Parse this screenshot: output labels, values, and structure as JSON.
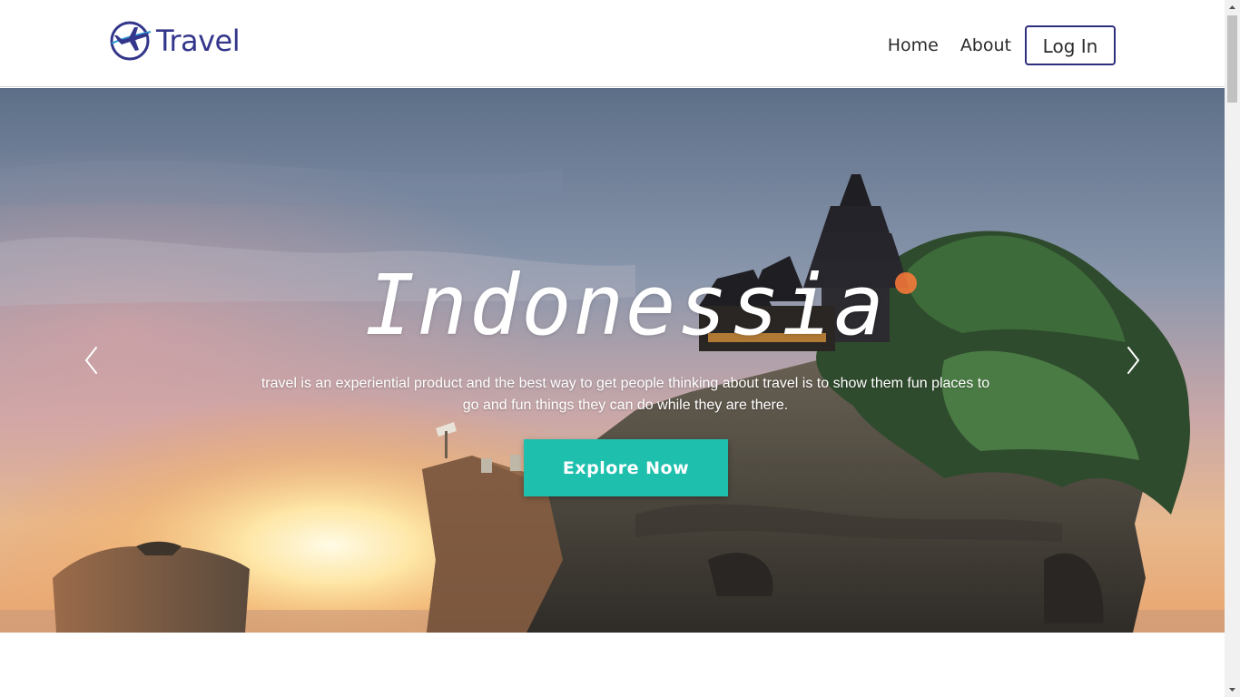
{
  "header": {
    "logo_text": "Travel",
    "nav": {
      "home": "Home",
      "about": "About",
      "login": "Log In"
    }
  },
  "hero": {
    "title": "Indonessia",
    "description": "travel is an experiential product and the best way to get people thinking about travel is to show them fun places to go and fun things they can do while they are there.",
    "cta_label": "Explore Now"
  },
  "colors": {
    "brand_navy": "#33368a",
    "cta_teal": "#1fbfae",
    "header_bg": "#ffffff"
  },
  "icons": {
    "logo": "airplane-globe-icon",
    "prev": "chevron-left-icon",
    "next": "chevron-right-icon"
  }
}
